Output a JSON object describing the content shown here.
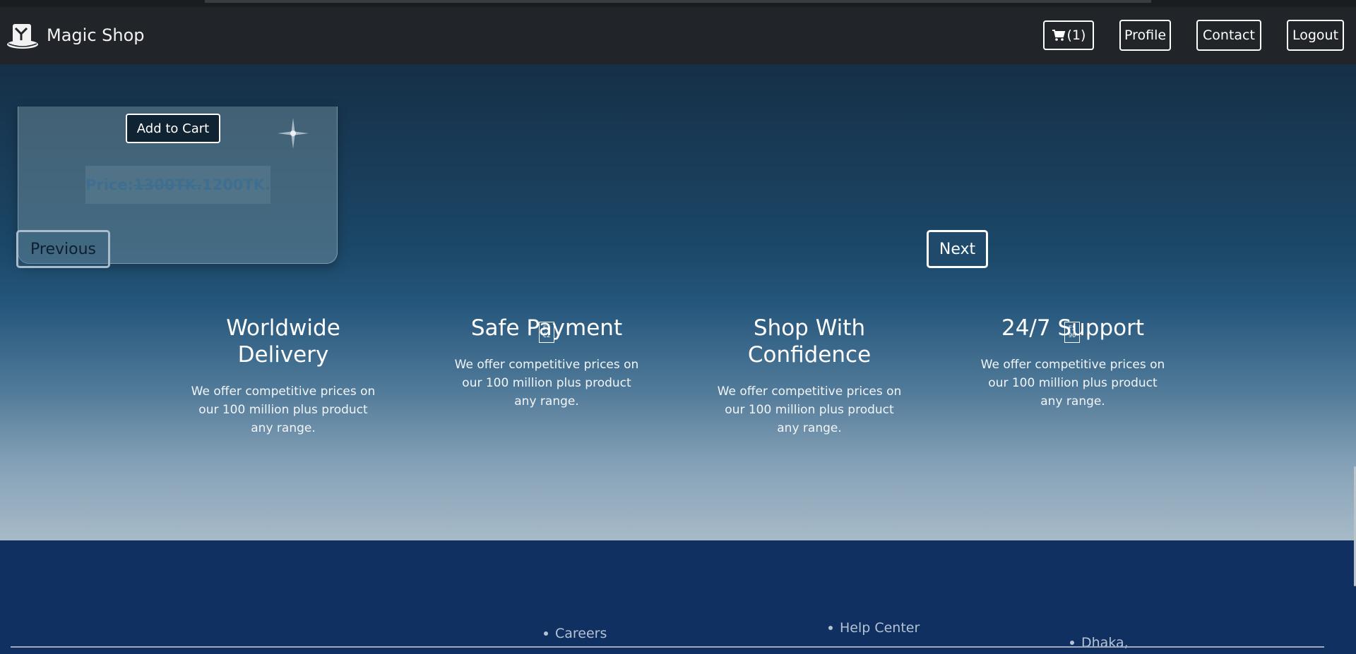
{
  "navbar": {
    "brand": "Magic Shop",
    "cart_label": "(1)",
    "profile_label": "Profile",
    "contact_label": "Contact",
    "logout_label": "Logout"
  },
  "product_card": {
    "add_to_cart_label": "Add to Cart",
    "price_prefix": "Price:",
    "price_old": "1300TK.",
    "price_new": "1200TK."
  },
  "pagination": {
    "previous_label": "Previous",
    "next_label": "Next"
  },
  "features": [
    {
      "title": "Worldwide Delivery",
      "text": "We offer competitive prices on our 100 million plus product any range."
    },
    {
      "title": "Safe Payment",
      "text": "We offer competitive prices on our 100 million plus product any range."
    },
    {
      "title": "Shop With Confidence",
      "text": "We offer competitive prices on our 100 million plus product any range."
    },
    {
      "title": "24/7 Support",
      "text": "We offer competitive prices on our 100 million plus product any range."
    }
  ],
  "feature_glyphs": [
    {
      "line1": "F2",
      "line2": "C2"
    },
    {
      "line1": "F5",
      "line2": "90"
    }
  ],
  "footer": {
    "links": [
      "Careers",
      "Help Center",
      "Dhaka,"
    ]
  },
  "icons": {
    "logo": "magic-hat-icon",
    "cart": "cart-icon",
    "sparkle": "sparkle-icon"
  },
  "colors": {
    "navbar": "#212529",
    "footer": "#0f3060",
    "hero_top": "#162f47",
    "hero_bottom": "#a7bac8"
  }
}
